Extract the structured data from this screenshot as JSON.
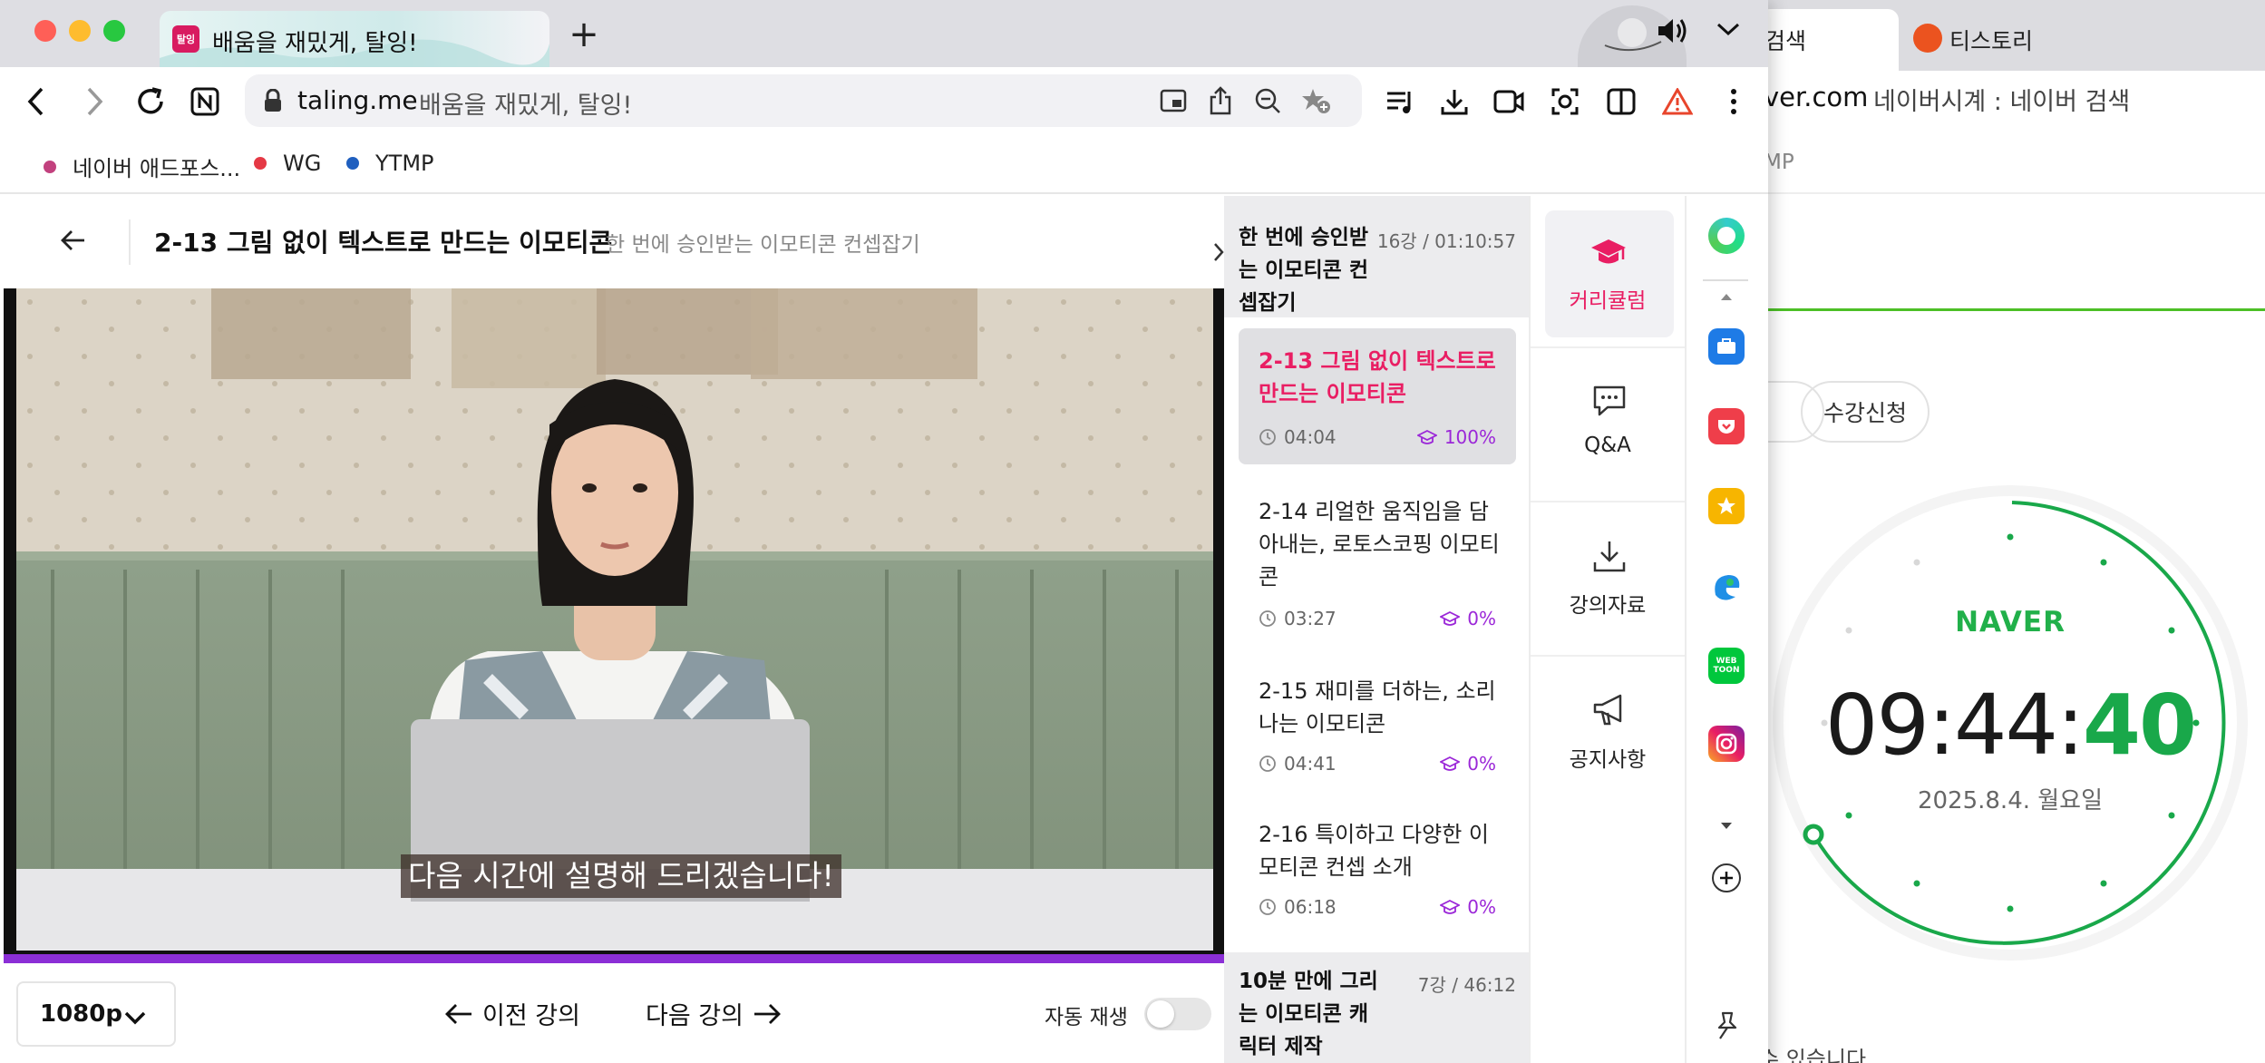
{
  "browser": {
    "tab": {
      "title": "배움을 재밌게, 탈잉!",
      "favicon_text": "탈잉"
    },
    "new_tab": "+",
    "url": {
      "domain": "taling.me",
      "title": "배움을 재밌게, 탈잉!"
    },
    "bookmarks": [
      {
        "label": "네이버 애드포스...",
        "color": "#c2417e"
      },
      {
        "label": "WG",
        "color": "#e53945"
      },
      {
        "label": "YTMP",
        "color": "#1f5fbf"
      }
    ]
  },
  "background_window": {
    "tab_search_fragment": "검색",
    "tab_tistory": "티스토리",
    "url_domain_fragment": "ver.com",
    "url_title": "네이버시계 : 네이버 검색",
    "bookmark_fragment": "MP",
    "enroll_chip": "수강신청",
    "clock": {
      "brand": "NAVER",
      "time_hm": "09:44:",
      "time_s": "40",
      "date": "2025.8.4. 월요일"
    },
    "bottom_fragment": "수 있습니다"
  },
  "lecture": {
    "title": "2-13 그림 없이 텍스트로 만드는 이모티콘",
    "course": "한 번에 승인받는 이모티콘 컨셉잡기",
    "subtitle_caption": "다음 시간에 설명해 드리겠습니다!",
    "progress_pct": 100
  },
  "controls": {
    "quality": "1080p",
    "prev": "이전 강의",
    "next": "다음 강의",
    "autoplay_label": "자동 재생",
    "autoplay_on": false
  },
  "curriculum": {
    "section1": {
      "title": "한 번에 승인받는 이모티콘 컨셉잡기",
      "meta": "16강 / 01:10:57"
    },
    "lessons": [
      {
        "title": "2-13 그림 없이 텍스트로 만드는 이모티콘",
        "duration": "04:04",
        "progress": "100%",
        "active": true
      },
      {
        "title": "2-14 리얼한 움직임을 담아내는, 로토스코핑 이모티콘",
        "duration": "03:27",
        "progress": "0%"
      },
      {
        "title": "2-15 재미를 더하는, 소리나는 이모티콘",
        "duration": "04:41",
        "progress": "0%"
      },
      {
        "title": "2-16 특이하고 다양한 이모티콘 컨셉 소개",
        "duration": "06:18",
        "progress": "0%"
      }
    ],
    "section2": {
      "title": "10분 만에 그리는 이모티콘 캐릭터 제작",
      "meta": "7강 / 46:12"
    }
  },
  "side_menu": {
    "curriculum": "커리큘럼",
    "qa": "Q&A",
    "materials": "강의자료",
    "notice": "공지사항"
  },
  "colors": {
    "accent": "#e91e63",
    "progress": "#8b2fd6",
    "naver_green": "#19a84a"
  }
}
